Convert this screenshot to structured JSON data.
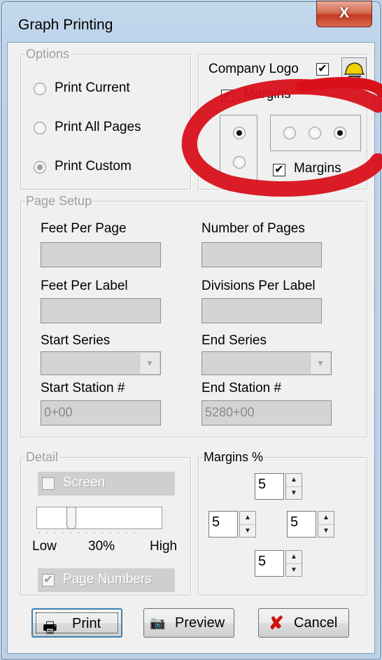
{
  "window": {
    "title": "Graph Printing",
    "close_glyph": "X"
  },
  "options": {
    "legend": "Options",
    "radios": [
      {
        "label": "Print Current",
        "checked": false
      },
      {
        "label": "Print All Pages",
        "checked": false
      },
      {
        "label": "Print Custom",
        "checked": true
      }
    ]
  },
  "logo_box": {
    "company_logo_label": "Company Logo",
    "company_logo_checked": true,
    "margins_label_top": "Margins",
    "margins_top_checked": true,
    "margins_label_bottom": "Margins",
    "margins_bottom_checked": true,
    "icon": "hard-hat-icon"
  },
  "page_setup": {
    "legend": "Page Setup",
    "feet_per_page_label": "Feet Per Page",
    "feet_per_page_value": "",
    "number_of_pages_label": "Number of Pages",
    "number_of_pages_value": "",
    "feet_per_label_label": "Feet Per Label",
    "feet_per_label_value": "",
    "divisions_per_label_label": "Divisions Per Label",
    "divisions_per_label_value": "",
    "start_series_label": "Start Series",
    "start_series_value": "",
    "end_series_label": "End Series",
    "end_series_value": "",
    "start_station_label": "Start Station #",
    "start_station_value": "0+00",
    "end_station_label": "End Station #",
    "end_station_value": "5280+00"
  },
  "detail": {
    "legend": "Detail",
    "screen_label": "Screen",
    "screen_checked": false,
    "slider_low": "Low",
    "slider_value": "30%",
    "slider_high": "High",
    "slider_fraction": 0.3,
    "page_numbers_label": "Page Numbers",
    "page_numbers_checked": true
  },
  "margins": {
    "legend": "Margins %",
    "top": "5",
    "left": "5",
    "right": "5",
    "bottom": "5"
  },
  "buttons": {
    "print": "Print",
    "preview": "Preview",
    "cancel": "Cancel"
  },
  "colors": {
    "annotation_red": "#d8101a",
    "cancel_x": "#cc1010"
  }
}
